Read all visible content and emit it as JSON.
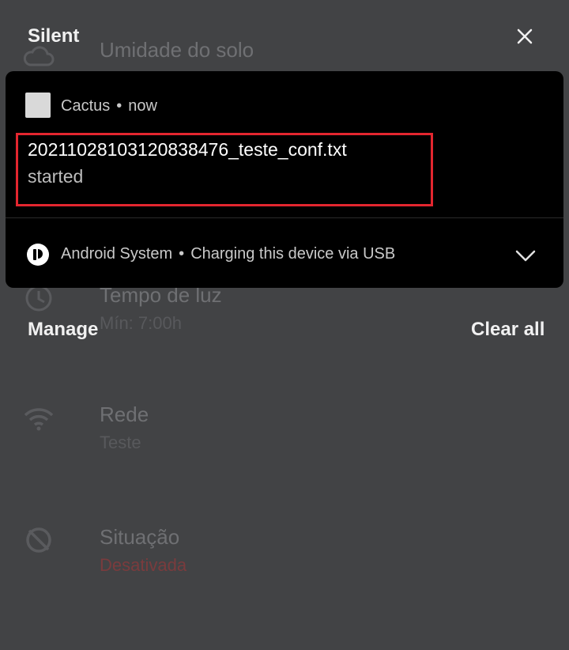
{
  "background_app": {
    "rows": [
      {
        "title": "Umidade do solo",
        "subtitle": ""
      },
      {
        "title": "Tempo de luz",
        "subtitle": "Mín: 7:00h"
      },
      {
        "title": "Rede",
        "subtitle": "Teste"
      },
      {
        "title": "Situação",
        "subtitle": "Desativada"
      }
    ]
  },
  "shade": {
    "section_label": "Silent",
    "manage_label": "Manage",
    "clear_all_label": "Clear all"
  },
  "notification": {
    "app_name": "Cactus",
    "time": "now",
    "title": "20211028103120838476_teste_conf.txt",
    "text": "started"
  },
  "system_notification": {
    "app_name": "Android System",
    "text": "Charging this device via USB"
  },
  "colors": {
    "scrim": "#424345",
    "card": "#000000",
    "highlight_border": "#e3262f",
    "status_red": "#7a3b3d"
  }
}
